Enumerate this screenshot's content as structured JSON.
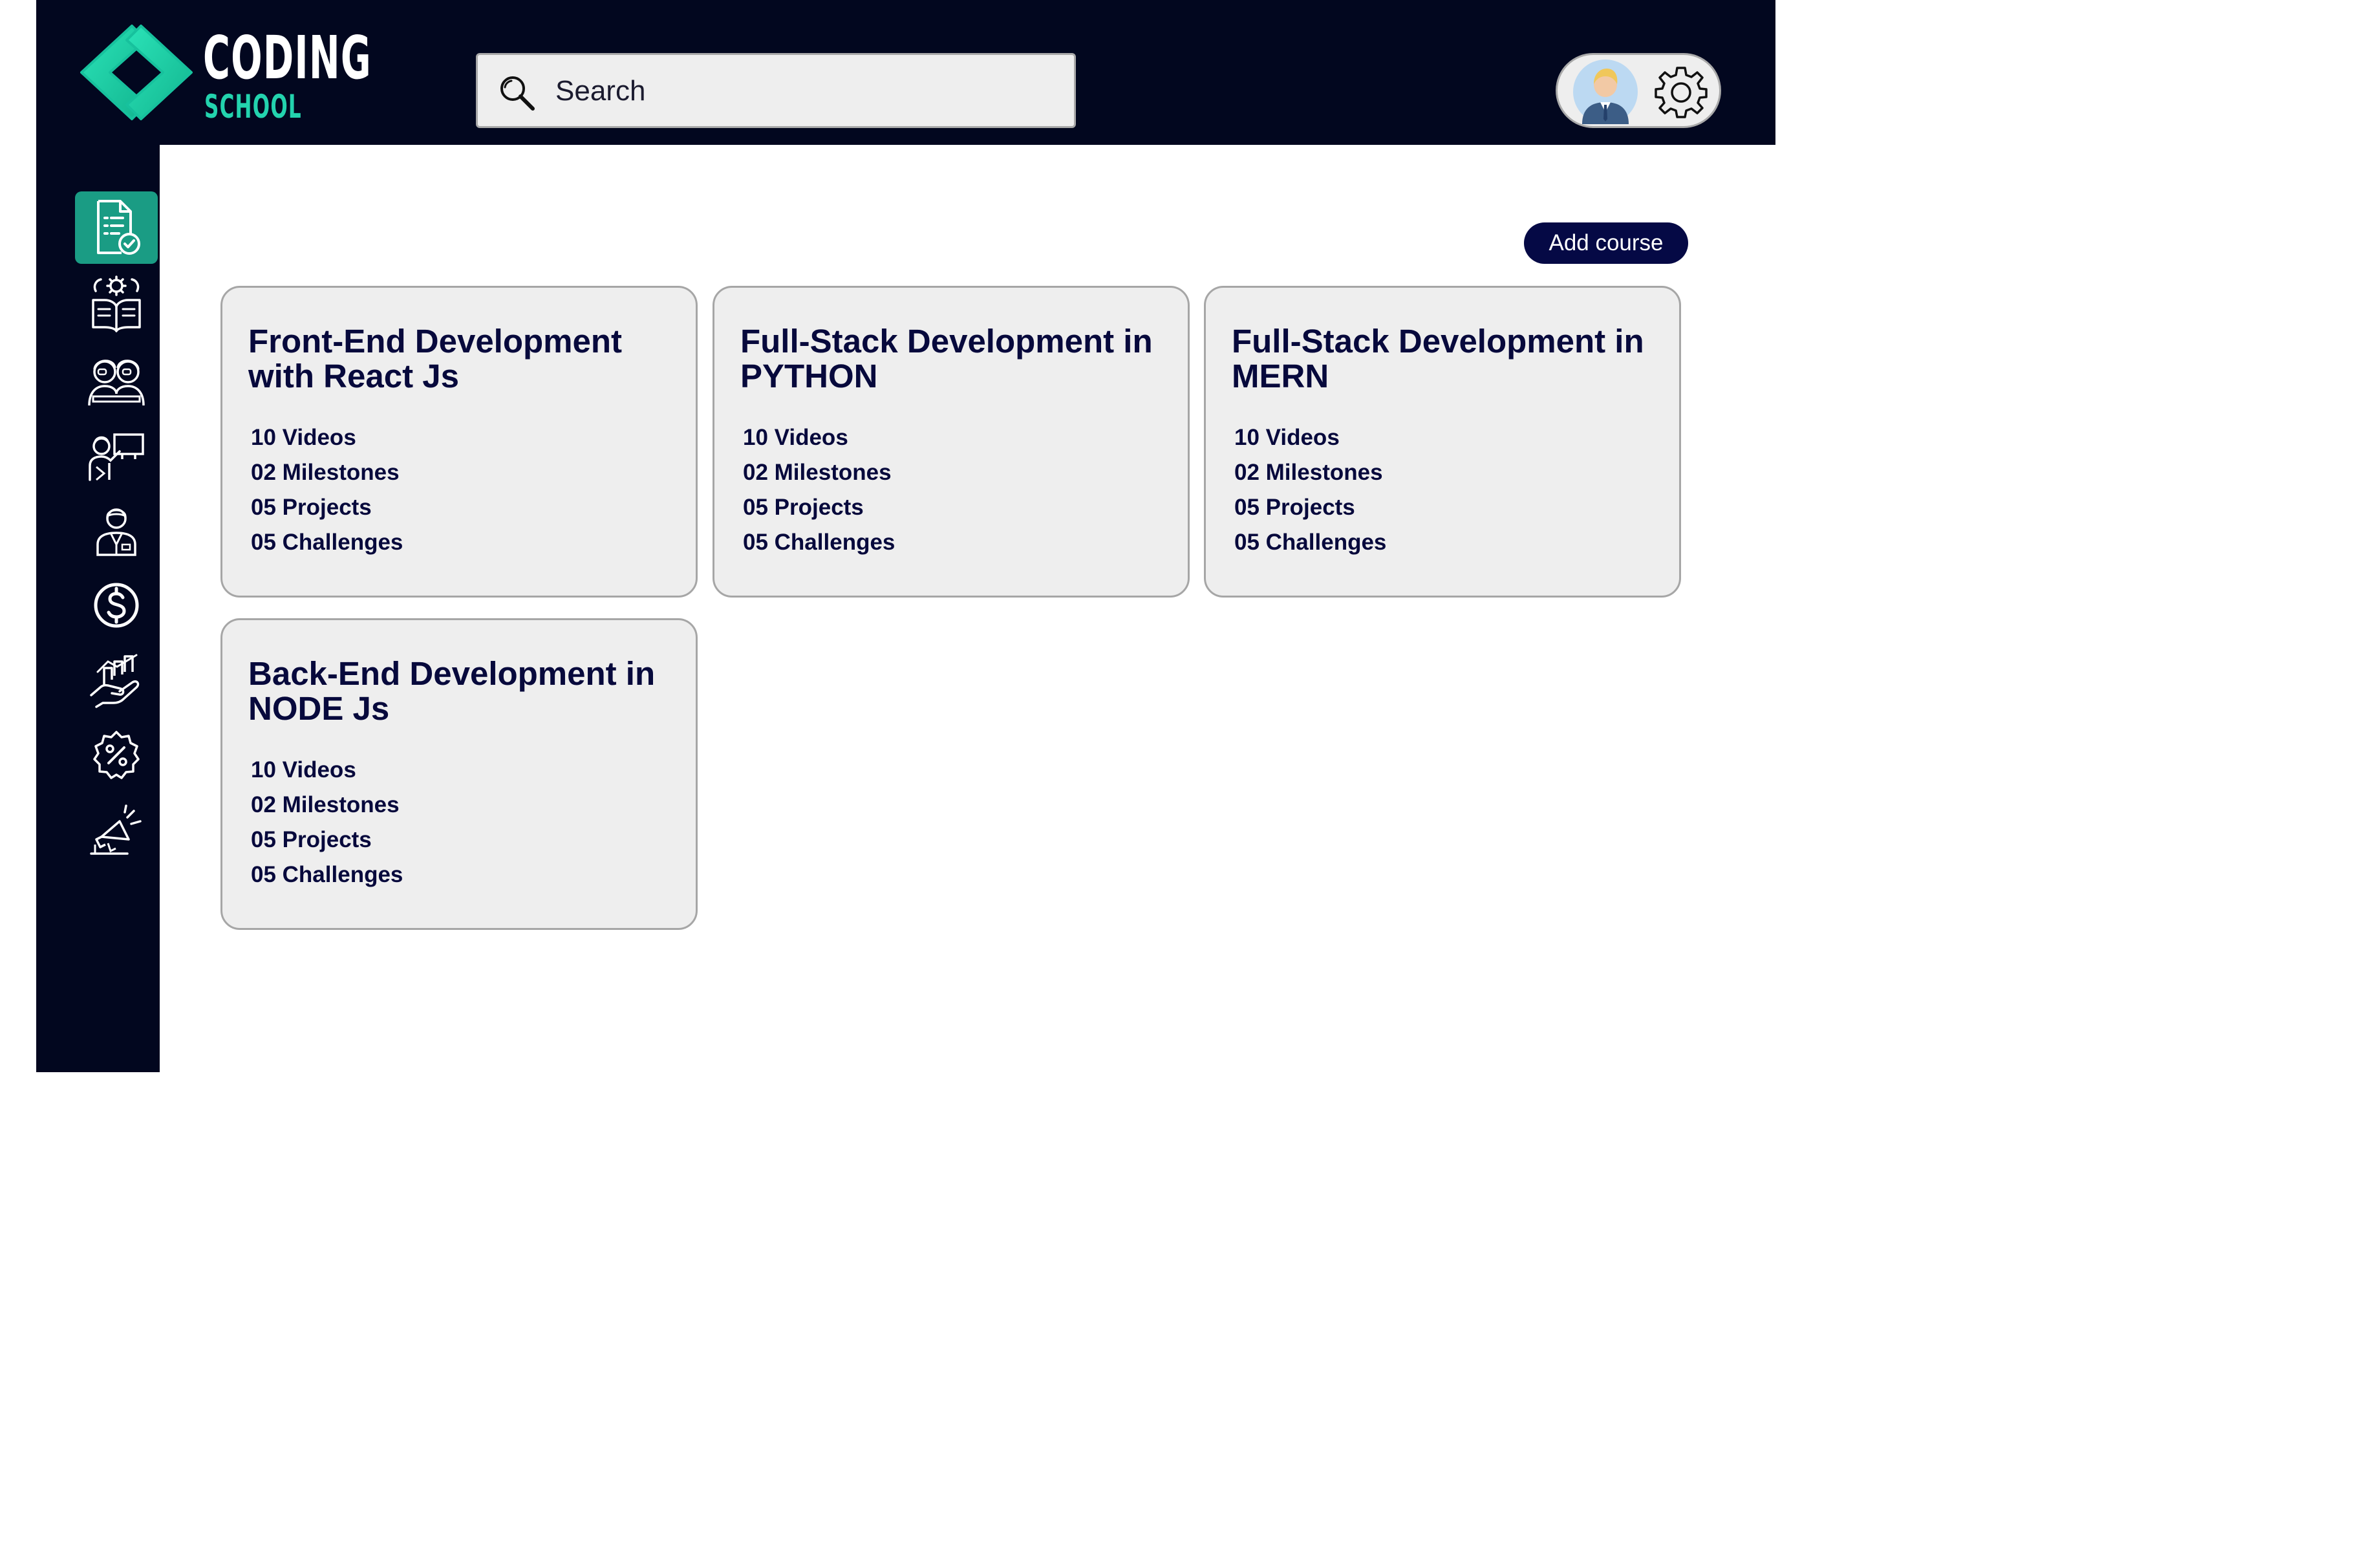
{
  "brand": {
    "line1": "CODING",
    "line2": "SCHOOL",
    "primary_color": "#23d3ae",
    "dark_color": "#02071f"
  },
  "search": {
    "placeholder": "Search",
    "icon": "search-icon"
  },
  "header": {
    "avatar_icon": "user-avatar",
    "settings_icon": "gear-icon"
  },
  "sidebar": {
    "items": [
      {
        "id": "courses",
        "icon": "document-check-icon",
        "active": true
      },
      {
        "id": "curriculum",
        "icon": "book-gear-icon",
        "active": false
      },
      {
        "id": "students",
        "icon": "students-icon",
        "active": false
      },
      {
        "id": "teaching",
        "icon": "presentation-icon",
        "active": false
      },
      {
        "id": "instructors",
        "icon": "instructor-icon",
        "active": false
      },
      {
        "id": "payments",
        "icon": "dollar-icon",
        "active": false
      },
      {
        "id": "growth",
        "icon": "growth-hand-icon",
        "active": false
      },
      {
        "id": "discounts",
        "icon": "discount-badge-icon",
        "active": false
      },
      {
        "id": "marketing",
        "icon": "megaphone-icon",
        "active": false
      }
    ]
  },
  "main": {
    "add_course_label": "Add course",
    "courses": [
      {
        "title": "Front-End Development with React Js",
        "stats": [
          "10 Videos",
          "02 Milestones",
          "05 Projects",
          "05 Challenges"
        ]
      },
      {
        "title": "Full-Stack Development in PYTHON",
        "stats": [
          "10 Videos",
          "02 Milestones",
          "05 Projects",
          "05 Challenges"
        ]
      },
      {
        "title": "Full-Stack Development in MERN",
        "stats": [
          "10 Videos",
          "02 Milestones",
          "05 Projects",
          "05 Challenges"
        ]
      },
      {
        "title": "Back-End Development in NODE Js",
        "stats": [
          "10 Videos",
          "02 Milestones",
          "05 Projects",
          "05 Challenges"
        ]
      }
    ]
  }
}
